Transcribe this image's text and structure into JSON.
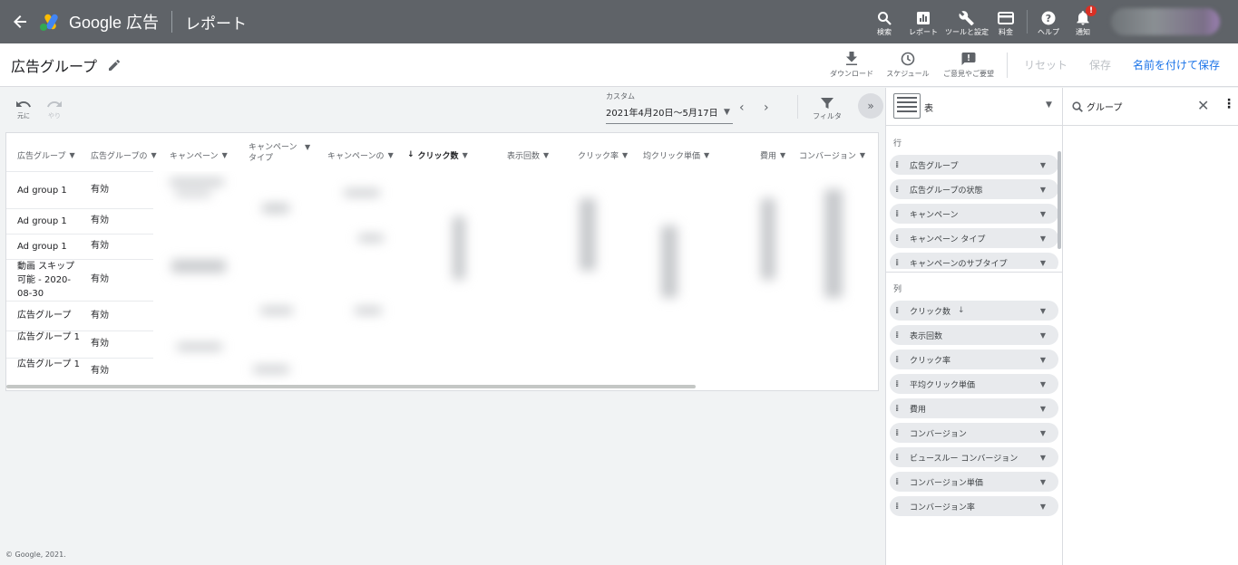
{
  "topbar": {
    "brand": "Google 広告",
    "section": "レポート",
    "buttons": [
      {
        "label": "検索",
        "icon": "search-icon"
      },
      {
        "label": "レポート",
        "icon": "reports-icon"
      },
      {
        "label": "ツールと設定",
        "icon": "wrench-icon"
      },
      {
        "label": "料金",
        "icon": "billing-icon"
      },
      {
        "label": "ヘルプ",
        "icon": "help-icon"
      },
      {
        "label": "通知",
        "icon": "bell-icon",
        "badge": "!"
      }
    ]
  },
  "subbar": {
    "title": "広告グループ",
    "download": "ダウンロード",
    "schedule": "スケジュール",
    "feedback": "ご意見やご要望",
    "reset": "リセット",
    "save": "保存",
    "save_as": "名前を付けて保存"
  },
  "toolbar": {
    "undo": "元に",
    "redo": "やり",
    "date_caption": "カスタム",
    "date_range": "2021年4月20日～5月17日",
    "filter": "フィルタ"
  },
  "table": {
    "headers": [
      "広告グループ",
      "広告グループの",
      "キャンペーン",
      "キャンペーン タイプ",
      "キャンペーンの",
      "クリック数",
      "表示回数",
      "クリック率",
      "均クリック単価",
      "費用",
      "コンバージョン"
    ],
    "rows": [
      {
        "name": "Ad group 1",
        "status": "有効"
      },
      {
        "name": "Ad group 1",
        "status": "有効"
      },
      {
        "name": "Ad group 1",
        "status": "有効"
      },
      {
        "name": "動画 スキップ可能 - 2020-08-30",
        "status": "有効"
      },
      {
        "name": "広告グループ",
        "status": "有効"
      },
      {
        "name": "広告グループ 1",
        "status": "有効"
      },
      {
        "name": "広告グループ 1",
        "status": "有効"
      }
    ]
  },
  "footer": {
    "copyright": "© Google, 2021."
  },
  "panel": {
    "visualization": "表",
    "rows_title": "行",
    "rows": [
      "広告グループ",
      "広告グループの状態",
      "キャンペーン",
      "キャンペーン タイプ",
      "キャンペーンのサブタイプ"
    ],
    "columns_title": "列",
    "columns": [
      "クリック数",
      "表示回数",
      "クリック率",
      "平均クリック単価",
      "費用",
      "コンバージョン",
      "ビュースルー コンバージョン",
      "コンバージョン単価",
      "コンバージョン率"
    ]
  },
  "field_search": {
    "value": "グループ"
  }
}
